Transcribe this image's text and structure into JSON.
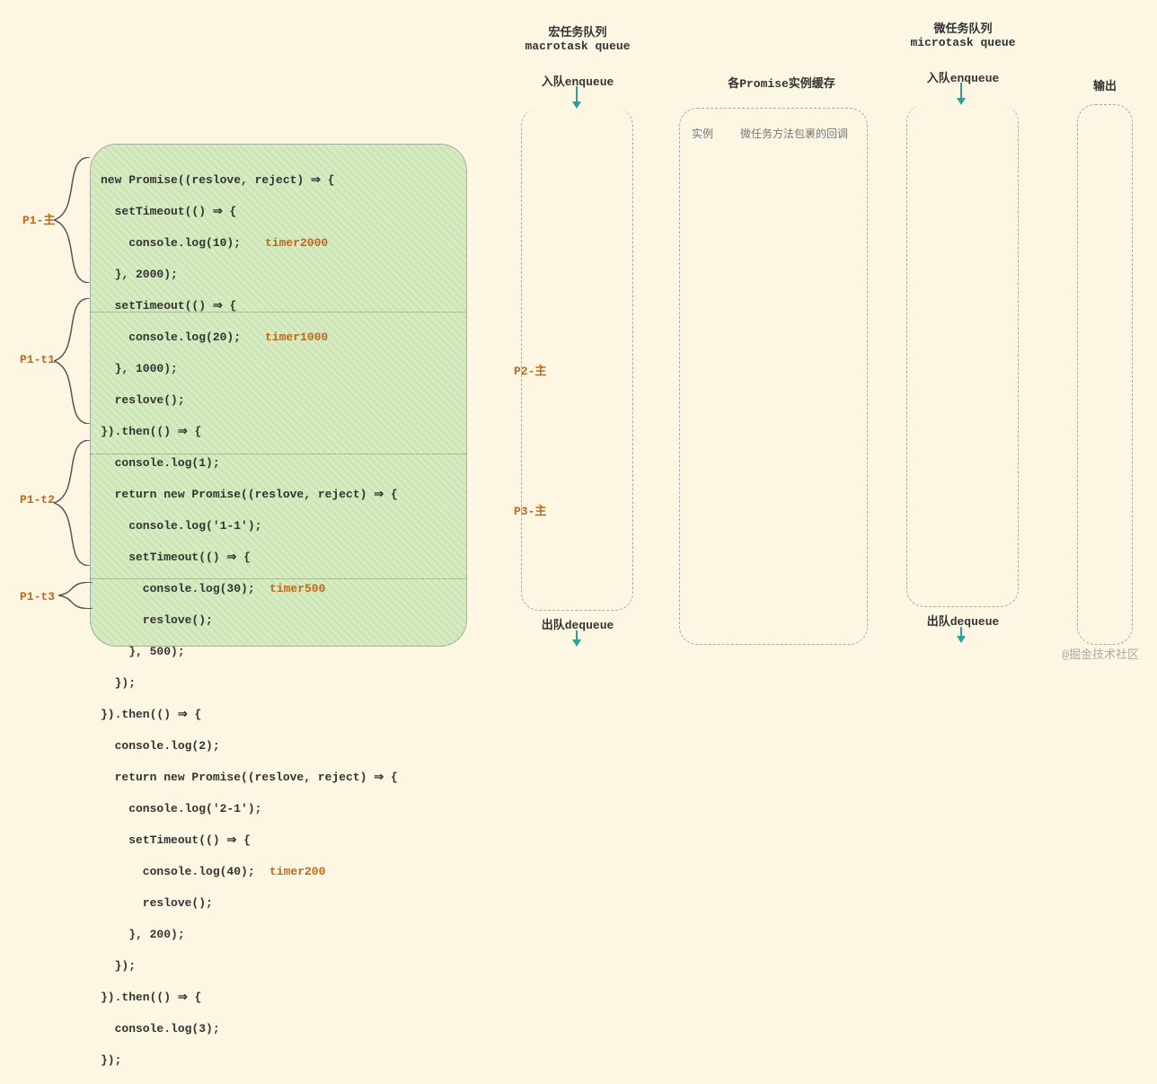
{
  "macrotask": {
    "title_cn": "宏任务队列",
    "title_en": "macrotask queue",
    "enqueue": "入队enqueue",
    "dequeue": "出队dequeue"
  },
  "microtask": {
    "title_cn": "微任务队列",
    "title_en": "microtask queue",
    "enqueue": "入队enqueue",
    "dequeue": "出队dequeue"
  },
  "promise_cache": {
    "title": "各Promise实例缓存",
    "col1": "实例",
    "col2": "微任务方法包裹的回调"
  },
  "output": {
    "title": "输出"
  },
  "side_labels": {
    "p1_main": "P1-主",
    "p1_t1": "P1-t1",
    "p1_t2": "P1-t2",
    "p1_t3": "P1-t3",
    "p2_main": "P2-主",
    "p3_main": "P3-主"
  },
  "timers": {
    "t2000": "timer2000",
    "t1000": "timer1000",
    "t500": "timer500",
    "t200": "timer200"
  },
  "code": {
    "l1": "new Promise((reslove, reject) ⇒ {",
    "l2": "  setTimeout(() ⇒ {",
    "l3": "    console.log(10);",
    "l4": "  }, 2000);",
    "l5": "  setTimeout(() ⇒ {",
    "l6": "    console.log(20);",
    "l7": "  }, 1000);",
    "l8": "  reslove();",
    "l9": "}).then(() ⇒ {",
    "l10": "  console.log(1);",
    "l11": "  return new Promise((reslove, reject) ⇒ {",
    "l12": "    console.log('1-1');",
    "l13": "    setTimeout(() ⇒ {",
    "l14": "      console.log(30);",
    "l15": "      reslove();",
    "l16": "    }, 500);",
    "l17": "  });",
    "l18": "}).then(() ⇒ {",
    "l19": "  console.log(2);",
    "l20": "  return new Promise((reslove, reject) ⇒ {",
    "l21": "    console.log('2-1');",
    "l22": "    setTimeout(() ⇒ {",
    "l23": "      console.log(40);",
    "l24": "      reslove();",
    "l25": "    }, 200);",
    "l26": "  });",
    "l27": "}).then(() ⇒ {",
    "l28": "  console.log(3);",
    "l29": "});"
  },
  "watermark": "@掘金技术社区"
}
